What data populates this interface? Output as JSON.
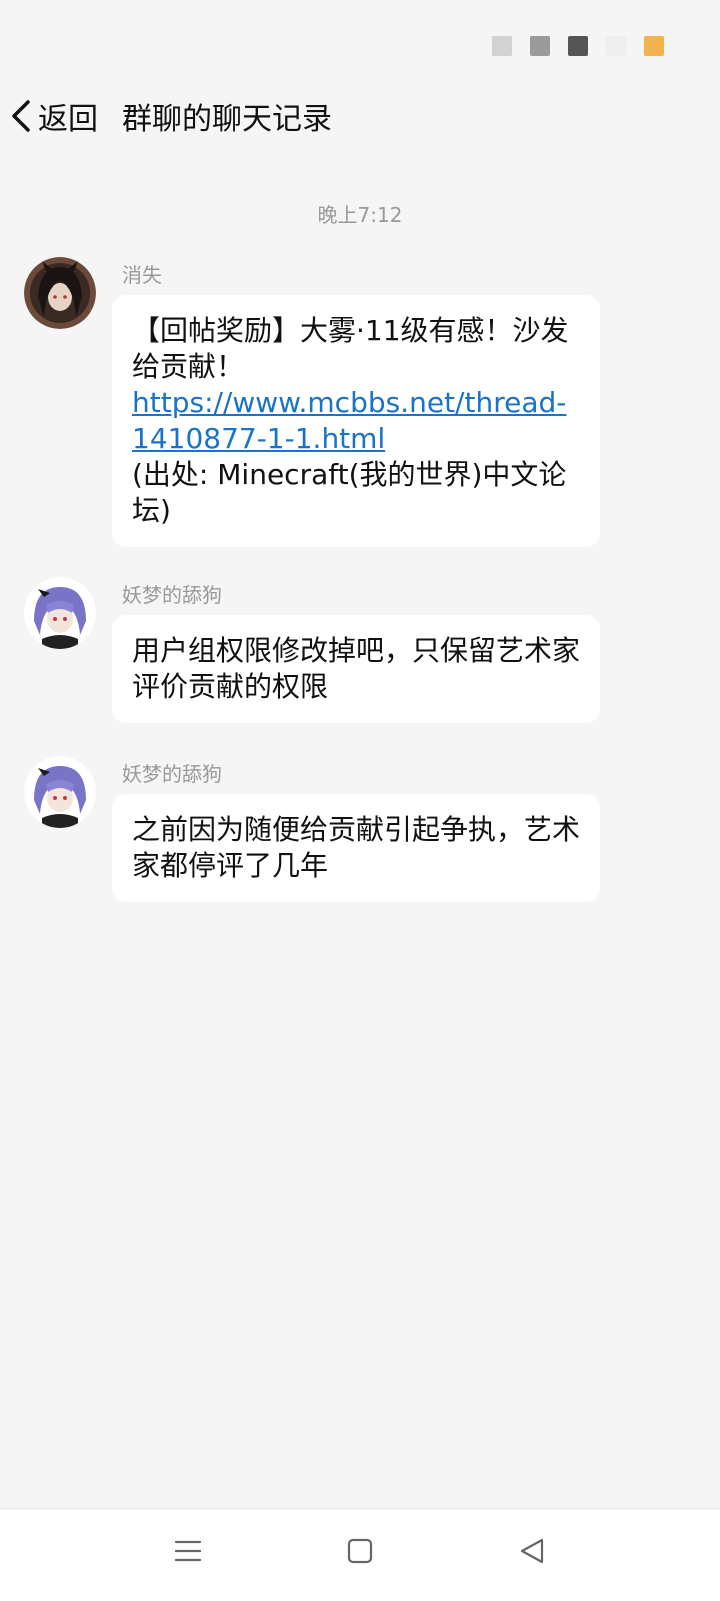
{
  "status_bar": {
    "indicators": [
      {
        "color": "#d2d2d2"
      },
      {
        "color": "#9a9a9a"
      },
      {
        "color": "#555555"
      },
      {
        "color": "#eeeeee"
      },
      {
        "color": "#f2b24c"
      }
    ]
  },
  "header": {
    "back_label": "返回",
    "back_icon": "chevron-left-icon",
    "title": "群聊的聊天记录"
  },
  "timestamp": "晚上7:12",
  "messages": [
    {
      "sender": "消失",
      "avatar_icon": "avatar-dark-hair",
      "text_before": "【回帖奖励】大雾·11级有感！沙发给贡献！",
      "link": "https://www.mcbbs.net/thread-1410877-1-1.html",
      "text_after": "(出处: Minecraft(我的世界)中文论坛)"
    },
    {
      "sender": "妖梦的舔狗",
      "avatar_icon": "avatar-purple-hair",
      "text": "用户组权限修改掉吧，只保留艺术家评价贡献的权限"
    },
    {
      "sender": "妖梦的舔狗",
      "avatar_icon": "avatar-purple-hair",
      "text": "之前因为随便给贡献引起争执，艺术家都停评了几年"
    }
  ],
  "nav_bar": {
    "menu_icon": "menu-icon",
    "home_icon": "home-square-icon",
    "back_icon": "back-triangle-icon"
  }
}
